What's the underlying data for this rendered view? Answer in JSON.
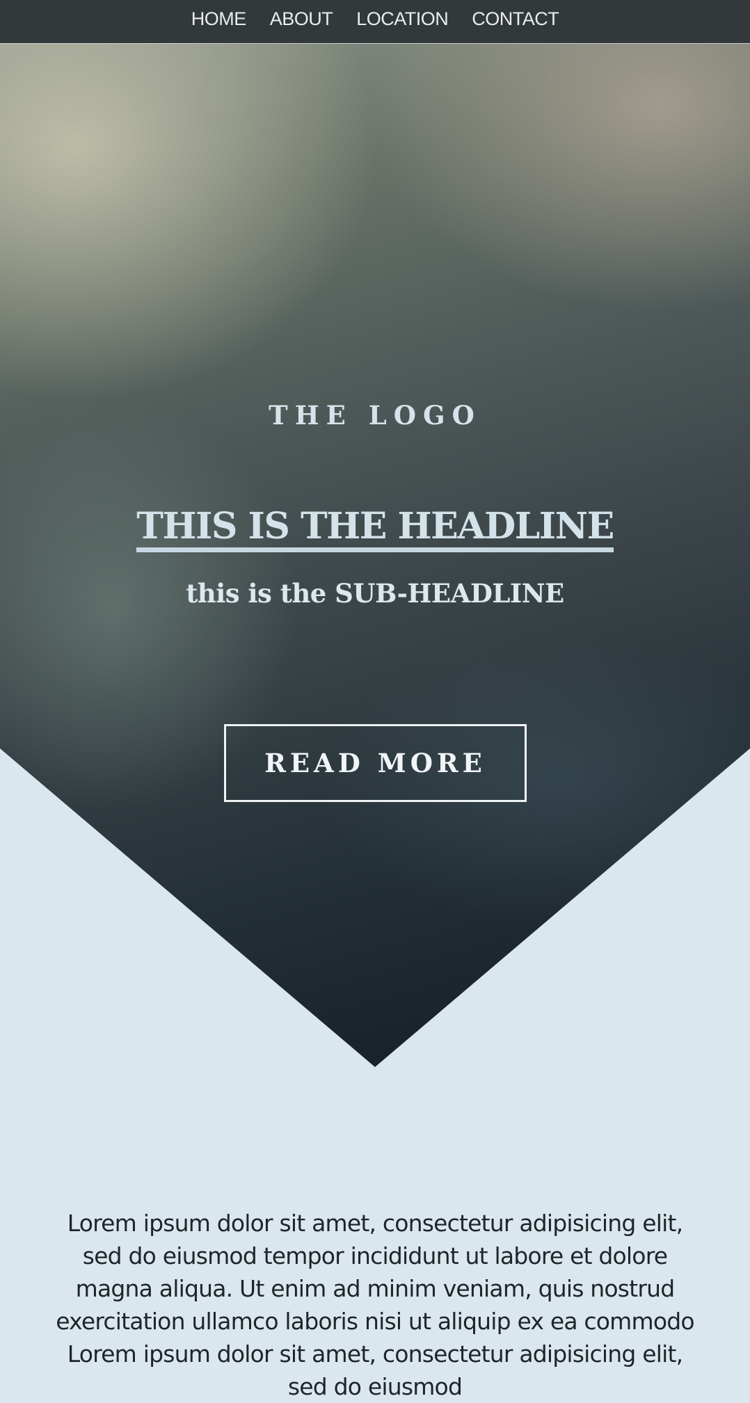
{
  "nav": {
    "items": [
      {
        "label": "HOME"
      },
      {
        "label": "ABOUT"
      },
      {
        "label": "LOCATION"
      },
      {
        "label": "CONTACT"
      }
    ]
  },
  "hero": {
    "logo": "THE LOGO",
    "headline": "THIS IS THE HEADLINE",
    "subheadline": "this is the SUB-HEADLINE",
    "cta_label": "READ MORE"
  },
  "content": {
    "paragraph": "Lorem ipsum dolor sit amet, consectetur adipisicing elit, sed do eiusmod tempor incididunt ut labore et dolore magna aliqua. Ut enim ad minim veniam, quis nostrud exercitation ullamco laboris nisi ut aliquip ex ea commodo Lorem ipsum dolor sit amet, consectetur adipisicing elit, sed do eiusmod"
  },
  "colors": {
    "nav_background": "#33383b",
    "page_background": "#dbe7ee",
    "hero_text": "#d4e2ea"
  }
}
